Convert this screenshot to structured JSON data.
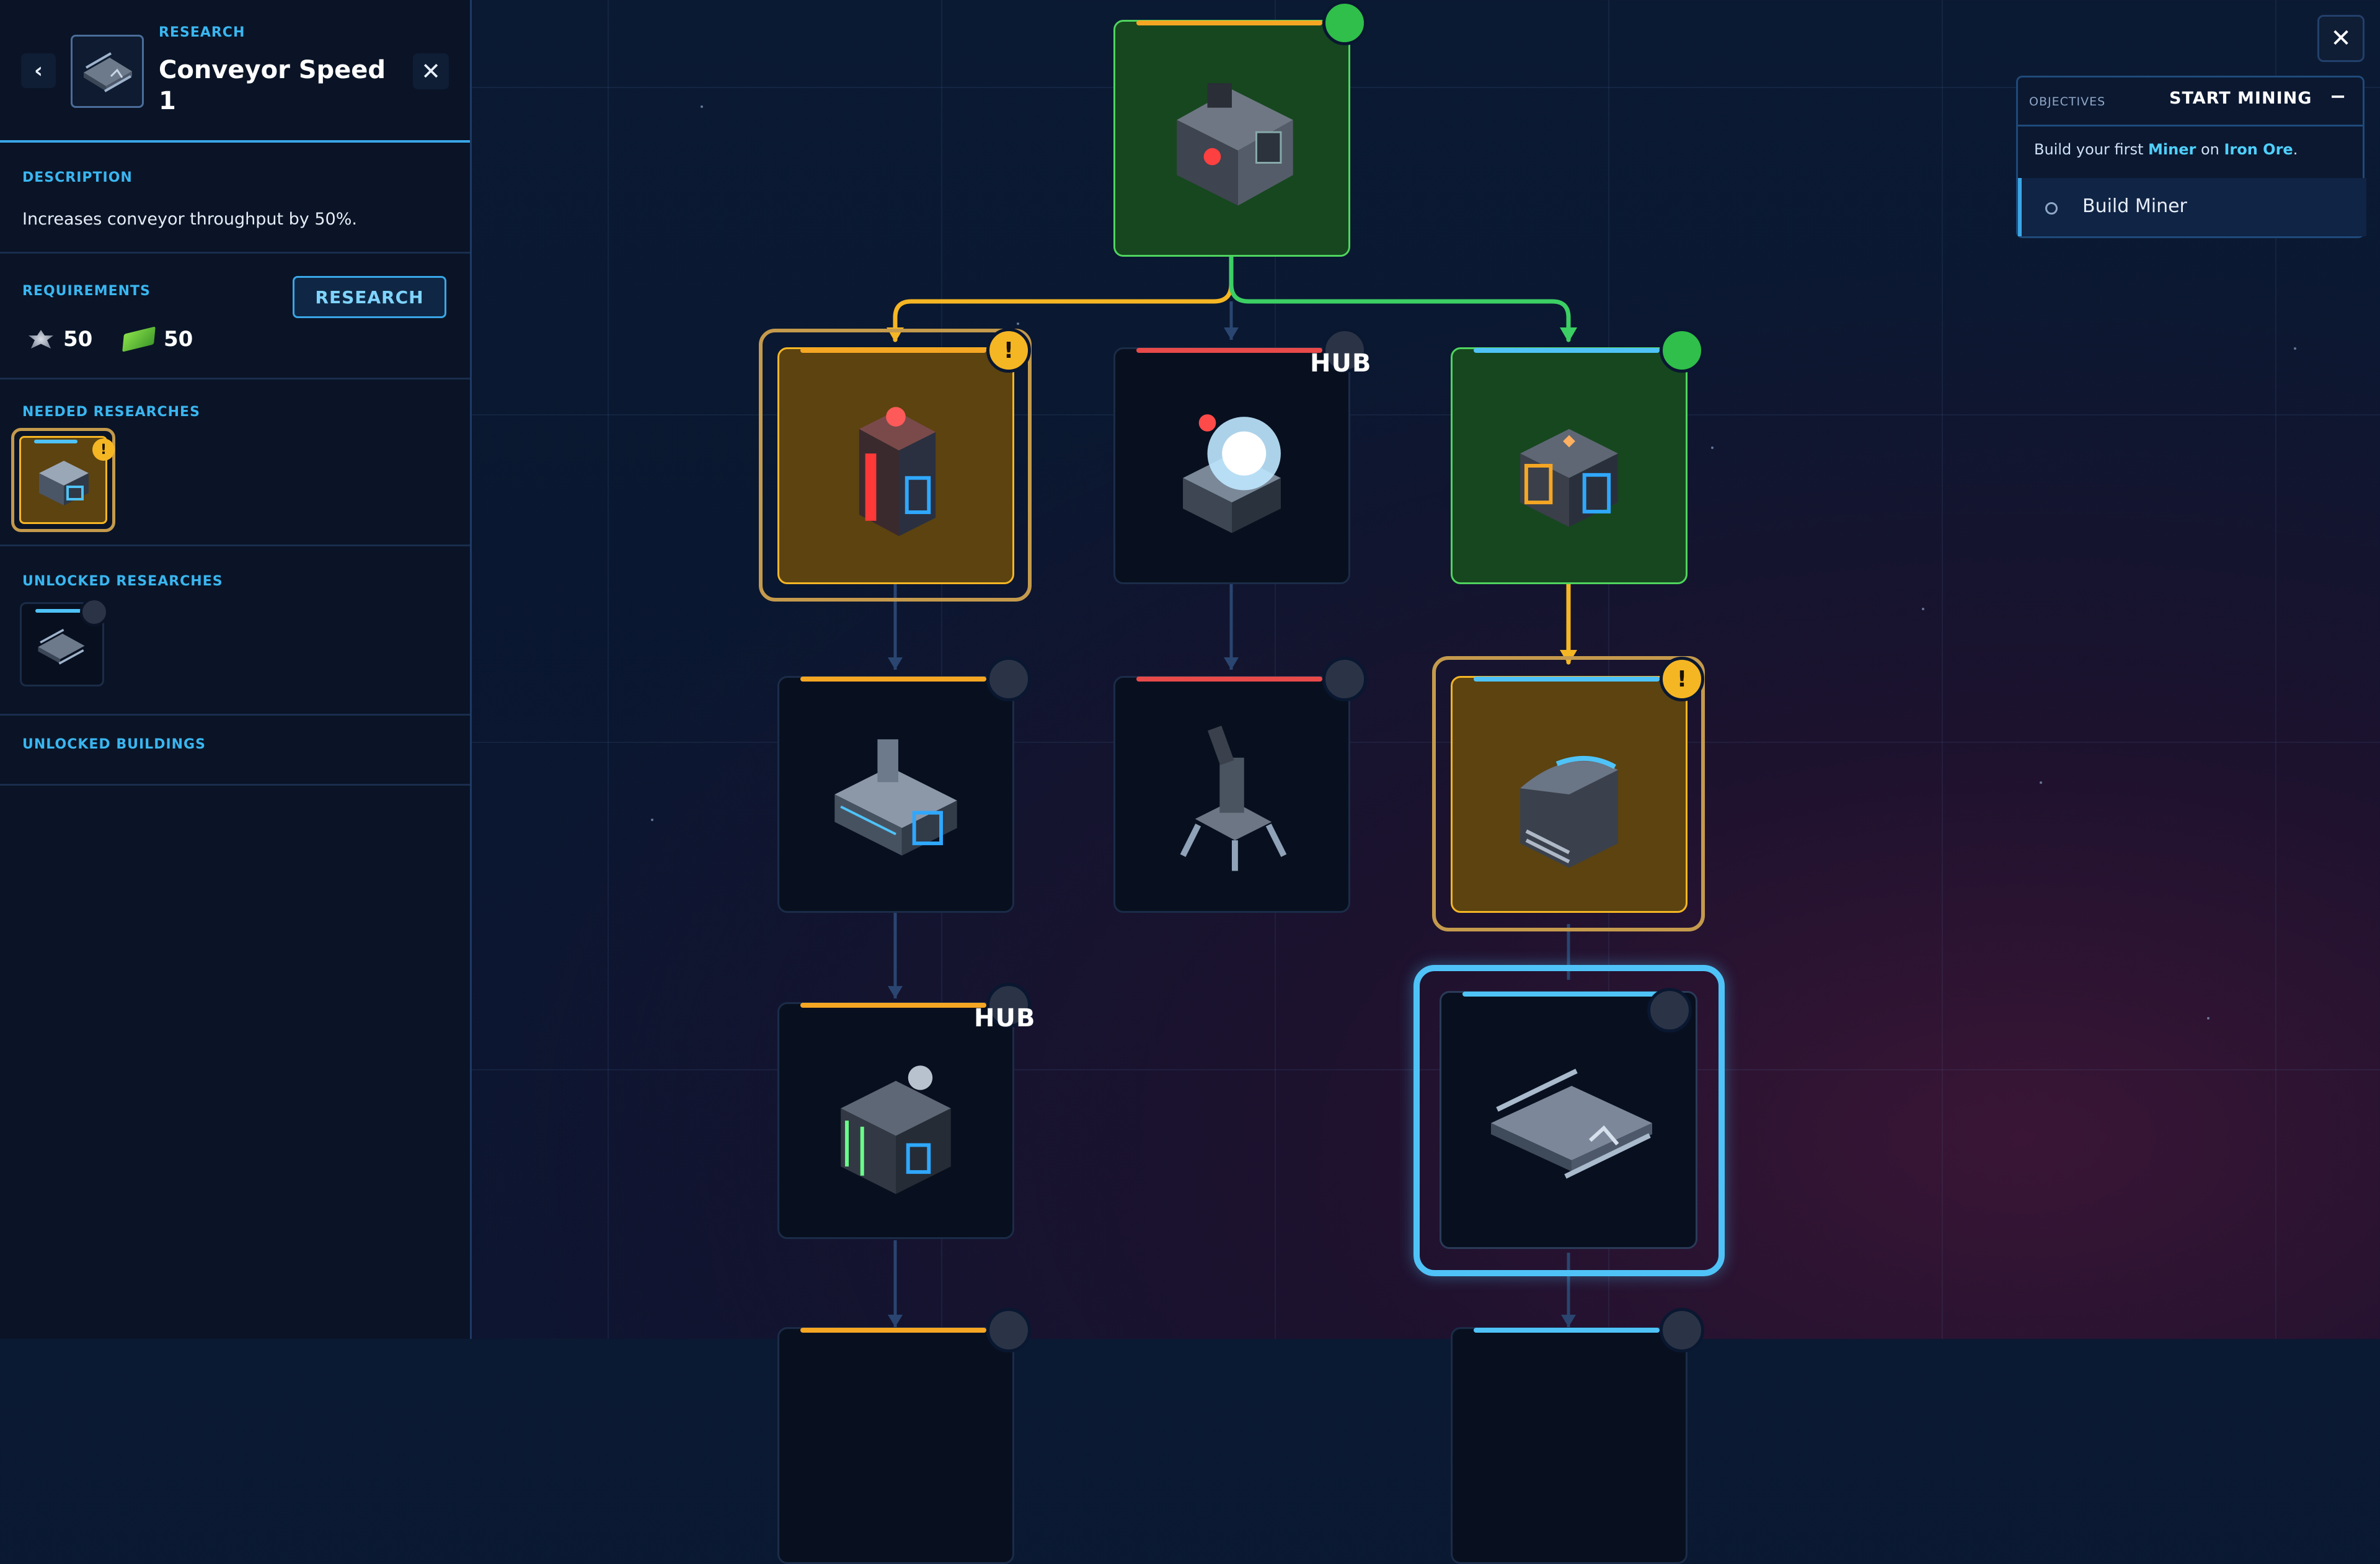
{
  "panel": {
    "kicker": "RESEARCH",
    "title": "Conveyor Speed 1",
    "back_icon": "‹",
    "close_icon": "✕",
    "description_label": "DESCRIPTION",
    "description": "Increases conveyor throughput by 50%.",
    "requirements_label": "REQUIREMENTS",
    "research_button": "RESEARCH",
    "costs": [
      {
        "icon": "iron-ore-icon",
        "amount": "50"
      },
      {
        "icon": "credits-icon",
        "amount": "50"
      }
    ],
    "needed_label": "NEEDED RESEARCHES",
    "unlocked_research_label": "UNLOCKED RESEARCHES",
    "unlocked_buildings_label": "UNLOCKED BUILDINGS",
    "warn_mark": "!"
  },
  "tree": {
    "hub_label": "HUB",
    "warn_mark": "!",
    "colors": {
      "orange": "#f5a623",
      "red": "#e84a4a",
      "cyan": "#4fc3f7",
      "green": "#2fbf4a",
      "gold": "#f5b624"
    }
  },
  "objectives": {
    "kicker": "OBJECTIVES",
    "title": "START MINING",
    "minimize": "−",
    "text_pre": "Build your first ",
    "text_b1": "Miner",
    "text_mid": " on ",
    "text_b2": "Iron Ore",
    "text_end": ".",
    "task": "Build Miner"
  },
  "global_close": "✕"
}
